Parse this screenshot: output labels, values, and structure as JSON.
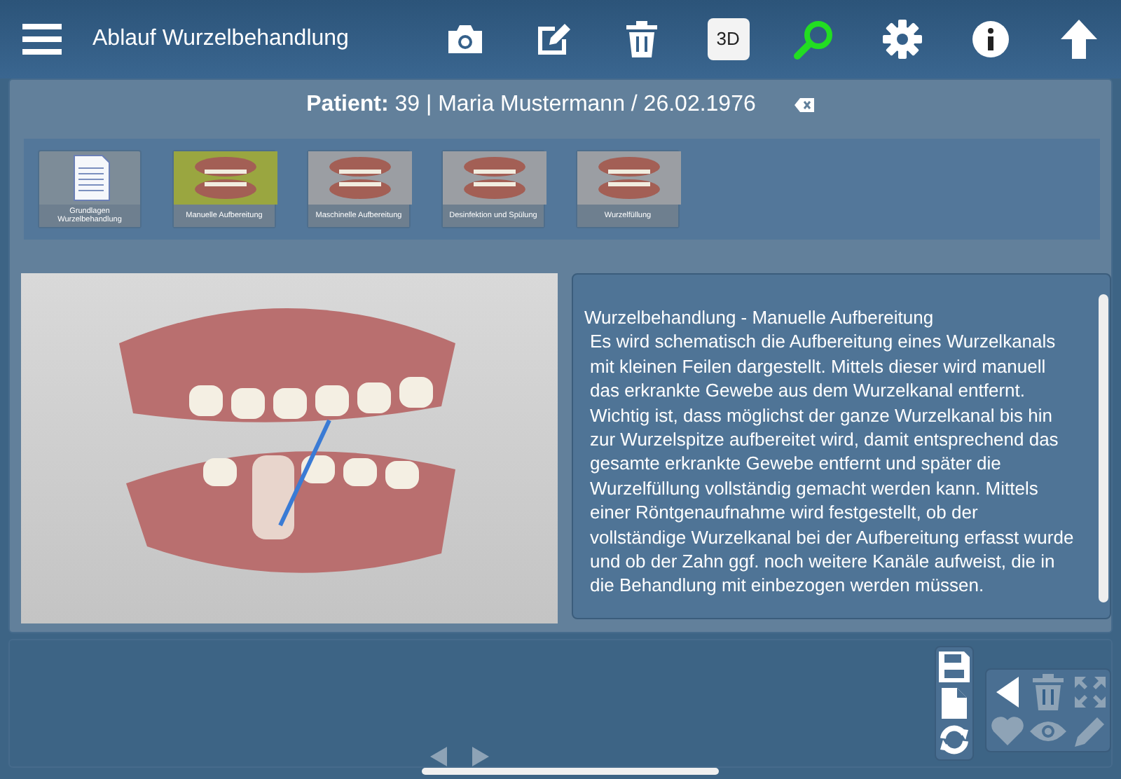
{
  "header": {
    "title": "Ablauf Wurzelbehandlung"
  },
  "toolbar": [
    {
      "kind": "camera",
      "active": false
    },
    {
      "kind": "edit",
      "active": false
    },
    {
      "kind": "trash",
      "active": false
    },
    {
      "kind": "text",
      "label": "3D",
      "active": false
    },
    {
      "kind": "search",
      "active": true
    },
    {
      "kind": "settings",
      "active": false
    },
    {
      "kind": "info",
      "active": false
    },
    {
      "kind": "up",
      "active": false
    }
  ],
  "patient": {
    "text": "**Patient:** 39 | Maria Mustermann / 26.02.1976"
  },
  "steps": [
    {
      "label": "Grundlagen Wurzelbehandlung",
      "kind": "document",
      "selected": false
    },
    {
      "label": "Manuelle Aufbereitung",
      "kind": "image",
      "selected": true
    },
    {
      "label": "Maschinelle Aufbereitung",
      "kind": "image",
      "selected": false
    },
    {
      "label": "Desinfektion und Spülung",
      "kind": "image",
      "selected": false
    },
    {
      "label": "Wurzelfüllung",
      "kind": "image",
      "selected": false
    }
  ],
  "description": {
    "title": "Wurzelbehandlung - Manuelle Aufbereitung",
    "body": "Es wird schematisch die Aufbereitung eines Wurzelkanals mit kleinen Feilen dargestellt. Mittels dieser wird manuell das erkrankte Gewebe aus dem Wurzelkanal entfernt. Wichtig ist, dass möglichst der ganze Wurzelkanal bis hin zur Wurzelspitze aufbereitet wird, damit entsprechend das gesamte erkrankte Gewebe entfernt und später die Wurzelfüllung vollständig gemacht werden kann. Mittels einer Röntgenaufnahme wird festgestellt, ob der vollständige Wurzelkanal bei der Aufbereitung erfasst wurde und ob der Zahn ggf. noch weitere Kanäle aufweist, die in die Behandlung mit einbezogen werden müssen."
  },
  "file_tools": [
    {
      "kind": "save"
    },
    {
      "kind": "document"
    },
    {
      "kind": "refresh"
    }
  ],
  "edit_tools": [
    {
      "kind": "back",
      "disabled": false
    },
    {
      "kind": "trash",
      "disabled": true
    },
    {
      "kind": "expand",
      "disabled": true
    },
    {
      "kind": "heart",
      "disabled": true
    },
    {
      "kind": "eye",
      "disabled": true
    },
    {
      "kind": "pencil",
      "disabled": true
    }
  ],
  "pager": [
    {
      "kind": "prev",
      "disabled": true
    },
    {
      "kind": "next",
      "disabled": true
    }
  ]
}
